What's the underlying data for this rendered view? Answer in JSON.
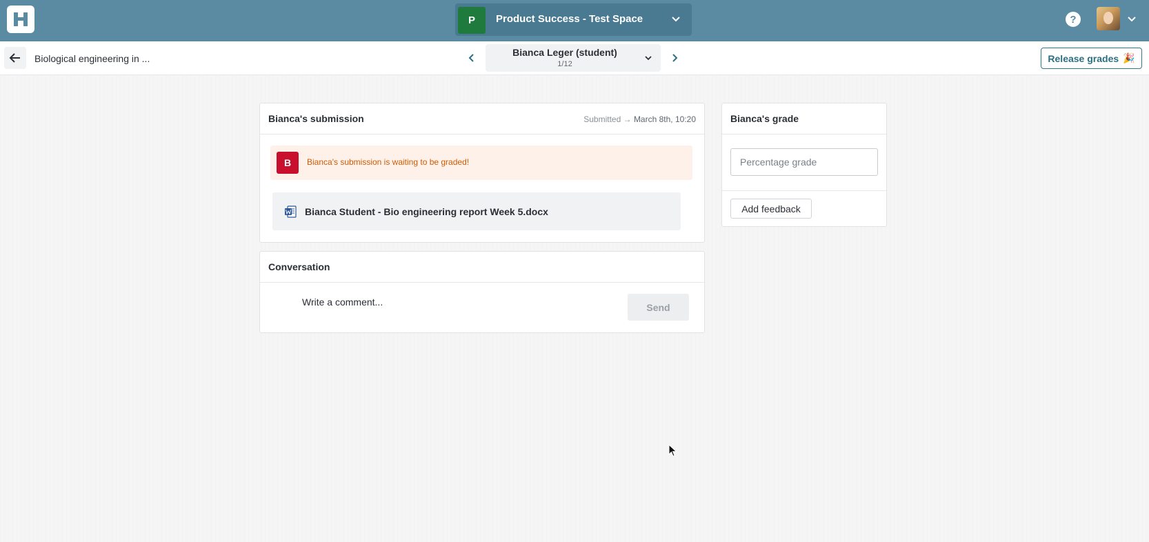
{
  "topbar": {
    "logo_letter": "H",
    "space": {
      "avatar_letter": "P",
      "name": "Product Success - Test Space"
    },
    "help_label": "?"
  },
  "subheader": {
    "assignment_title": "Biological engineering in ...",
    "student": {
      "name": "Bianca Leger (student)",
      "position": "1/12"
    },
    "release_label": "Release grades",
    "release_emoji": "🎉"
  },
  "submission": {
    "title": "Bianca's submission",
    "submitted_label": "Submitted",
    "arrow": "→",
    "submitted_date": "March 8th, 10:20",
    "banner": {
      "avatar_letter": "B",
      "text": "Bianca's submission is waiting to be graded!"
    },
    "attachment": {
      "icon": "word-doc-icon",
      "name": "Bianca Student - Bio engineering report Week 5.docx"
    }
  },
  "conversation": {
    "title": "Conversation",
    "comment_placeholder": "Write a comment...",
    "send_label": "Send"
  },
  "grade": {
    "title": "Bianca's grade",
    "grade_placeholder": "Percentage grade",
    "feedback_label": "Add feedback"
  },
  "colors": {
    "topbar": "#5b8ba3",
    "space_avatar": "#1f7a3d",
    "student_avatar": "#c8102e",
    "banner_bg": "#fdf1e9",
    "banner_text": "#d05a00",
    "accent": "#2d7a8c"
  }
}
